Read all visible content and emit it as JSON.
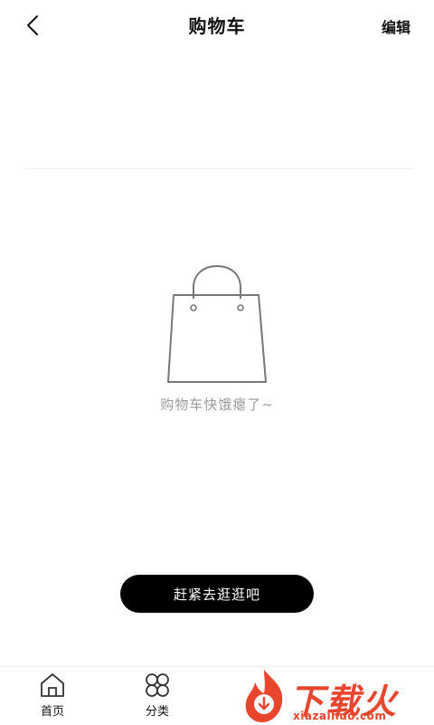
{
  "header": {
    "title": "购物车",
    "edit_label": "编辑"
  },
  "empty_state": {
    "message": "购物车快饿瘪了~",
    "button_label": "赶紧去逛逛吧"
  },
  "tabbar": {
    "items": [
      {
        "label": "首页",
        "icon": "home-icon"
      },
      {
        "label": "分类",
        "icon": "category-icon"
      }
    ]
  },
  "watermark": {
    "text": "下载火",
    "url": "xiazaihuo.com",
    "color": "#e8452e"
  }
}
